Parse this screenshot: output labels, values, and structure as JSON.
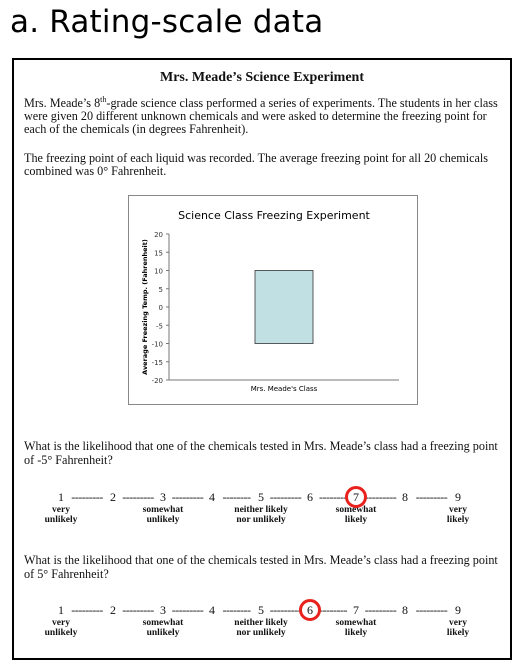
{
  "heading": "a. Rating-scale data",
  "card": {
    "title": "Mrs. Meade’s Science Experiment",
    "para1_a": "Mrs. Meade’s 8",
    "para1_sup": "th",
    "para1_b": "-grade science class performed a series of experiments.  The students in her class were given 20 different unknown chemicals and were asked to determine the freezing point for each of the chemicals (in degrees Fahrenheit).",
    "para2": "The freezing point of each liquid was recorded. The average freezing point for all 20 chemicals combined was 0° Fahrenheit."
  },
  "chart_data": {
    "type": "bar",
    "title": "Science Class Freezing Experiment",
    "categories": [
      "Mrs. Meade's Class"
    ],
    "values": [
      0
    ],
    "ylabel": "Average Freezing Temp. (Fahrenheit)",
    "xlabel": "",
    "ylim": [
      -20,
      20
    ],
    "yticks": [
      20,
      15,
      10,
      5,
      0,
      -5,
      -10,
      -15,
      -20
    ],
    "bar_color": "#c1e0e4",
    "grid": false
  },
  "scale": {
    "numbers": [
      "1",
      "2",
      "3",
      "4",
      "5",
      "6",
      "7",
      "8",
      "9"
    ],
    "dashes": [
      "---------",
      "---------",
      "---------",
      "--------",
      "---------",
      "--------",
      "---------",
      "---------"
    ],
    "anchors": [
      {
        "l1": "very",
        "l2": "unlikely"
      },
      {
        "l1": "somewhat",
        "l2": "unlikely"
      },
      {
        "l1": "neither likely",
        "l2": "nor unlikely"
      },
      {
        "l1": "somewhat",
        "l2": "likely"
      },
      {
        "l1": "very",
        "l2": "likely"
      }
    ]
  },
  "questions": [
    {
      "text": "What is the likelihood that one of the chemicals tested in Mrs. Meade’s class had a freezing point of -5° Fahrenheit?",
      "selected": 7
    },
    {
      "text": "What is the likelihood that one of the chemicals tested in Mrs. Meade’s class had a freezing point of 5° Fahrenheit?",
      "selected": 6
    }
  ],
  "colors": {
    "selection_circle": "#e8231d",
    "bar": "#c1e0e4"
  }
}
